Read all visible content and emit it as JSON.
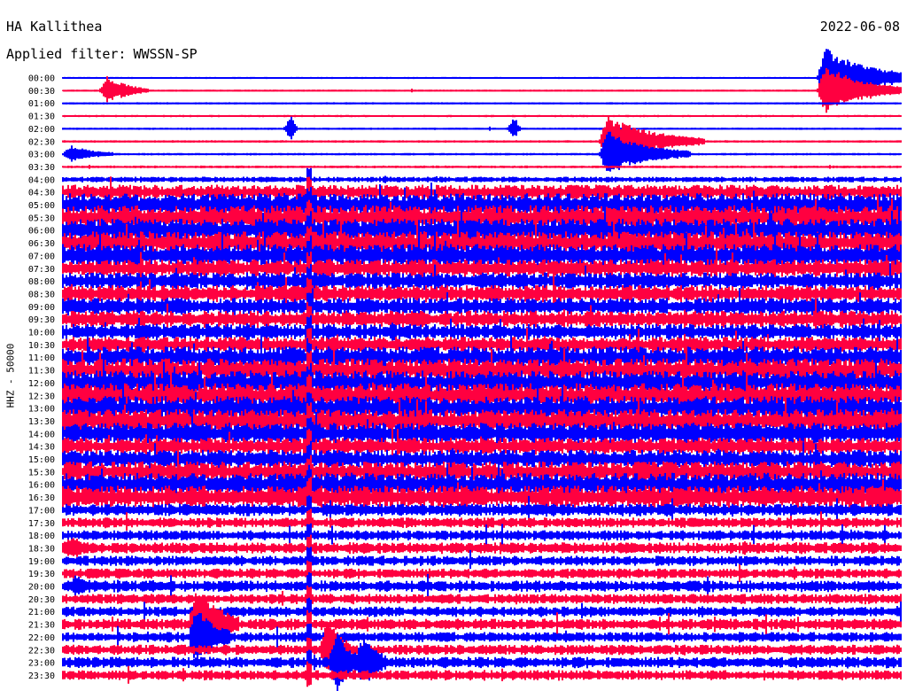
{
  "header": {
    "station": "HA Kallithea",
    "date": "2022-06-08",
    "filter_label": "Applied filter:",
    "filter_value": "WWSSN-SP"
  },
  "chart_data": {
    "type": "line",
    "title": "HA Kallithea",
    "ylabel": "HHZ - 50000",
    "tick_labels": [
      "00:00",
      "00:30",
      "01:00",
      "01:30",
      "02:00",
      "02:30",
      "03:00",
      "03:30",
      "04:00",
      "04:30",
      "05:00",
      "05:30",
      "06:00",
      "06:30",
      "07:00",
      "07:30",
      "08:00",
      "08:30",
      "09:00",
      "09:30",
      "10:00",
      "10:30",
      "11:00",
      "11:30",
      "12:00",
      "12:30",
      "13:00",
      "13:30",
      "14:00",
      "14:30",
      "15:00",
      "15:30",
      "16:00",
      "16:30",
      "17:00",
      "17:30",
      "18:00",
      "18:30",
      "19:00",
      "19:30",
      "20:00",
      "20:30",
      "21:00",
      "21:30",
      "22:00",
      "22:30",
      "23:00",
      "23:30"
    ],
    "noise_level": [
      0.04,
      0.04,
      0.05,
      0.05,
      0.05,
      0.06,
      0.06,
      0.07,
      0.2,
      0.6,
      0.95,
      1.0,
      0.95,
      0.95,
      0.95,
      0.75,
      0.7,
      0.7,
      0.7,
      0.7,
      0.65,
      0.65,
      0.9,
      0.95,
      1.0,
      1.0,
      1.0,
      0.95,
      0.9,
      0.7,
      0.75,
      0.85,
      0.95,
      0.95,
      0.5,
      0.4,
      0.4,
      0.45,
      0.4,
      0.4,
      0.45,
      0.4,
      0.4,
      0.45,
      0.4,
      0.4,
      0.45,
      0.4
    ],
    "series_colors": [
      "#0000ff",
      "#ff0040"
    ],
    "events": [
      {
        "trace": 1,
        "minute": 1.6,
        "amp": 1.4,
        "dur": 1.5
      },
      {
        "trace": 0,
        "minute": 27.3,
        "amp": 2.8,
        "dur": 3.5
      },
      {
        "trace": 1,
        "minute": 27.3,
        "amp": 2.4,
        "dur": 3
      },
      {
        "trace": 5,
        "minute": 19.5,
        "amp": 2.4,
        "dur": 3.5
      },
      {
        "trace": 6,
        "minute": 19.5,
        "amp": 2.2,
        "dur": 3
      },
      {
        "trace": 6,
        "minute": 0.3,
        "amp": 0.8,
        "dur": 1.5
      },
      {
        "trace": 4,
        "minute": 8.2,
        "amp": 1.2,
        "dur": 0.2
      },
      {
        "trace": 4,
        "minute": 16.2,
        "amp": 1.2,
        "dur": 0.2
      },
      {
        "trace": 43,
        "minute": 4.8,
        "amp": 3.5,
        "dur": 1.5
      },
      {
        "trace": 44,
        "minute": 4.8,
        "amp": 2.8,
        "dur": 1.2
      },
      {
        "trace": 45,
        "minute": 9.5,
        "amp": 3.0,
        "dur": 0.8
      },
      {
        "trace": 46,
        "minute": 9.8,
        "amp": 2.5,
        "dur": 1.0
      },
      {
        "trace": 46,
        "minute": 10.8,
        "amp": 2.2,
        "dur": 0.8
      },
      {
        "trace": 37,
        "minute": 0.3,
        "amp": 0.8,
        "dur": 0.8
      },
      {
        "trace": 40,
        "minute": 0.5,
        "amp": 0.7,
        "dur": 0.8
      }
    ],
    "spike_minute": 8.8
  }
}
